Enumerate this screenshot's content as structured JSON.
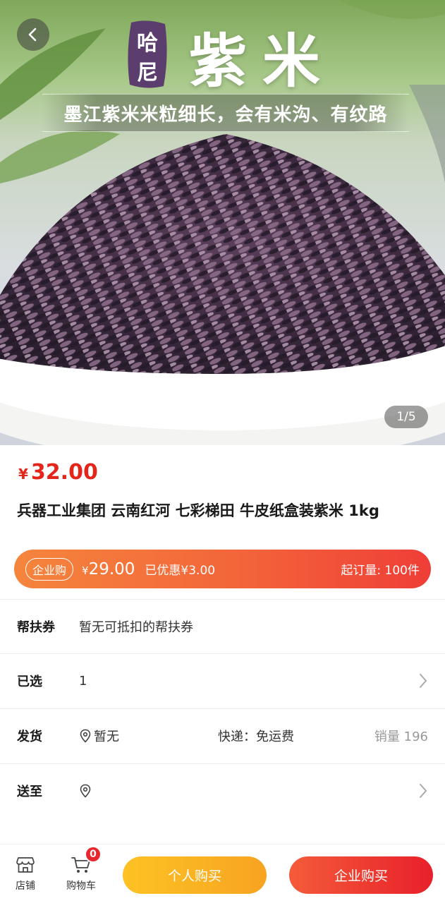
{
  "hero": {
    "brand_badge_line1": "哈",
    "brand_badge_line2": "尼",
    "title": "紫米",
    "subtitle": "墨江紫米米粒细长，会有米沟、有纹路",
    "pager": "1/5"
  },
  "product": {
    "currency_symbol": "¥",
    "price": "32.00",
    "title": "兵器工业集团 云南红河 七彩梯田 牛皮纸盒装紫米 1kg"
  },
  "enterprise": {
    "tag": "企业购",
    "currency_symbol": "¥",
    "price": "29.00",
    "saving": "已优惠¥3.00",
    "min_order": "起订量: 100件"
  },
  "rows": {
    "coupon": {
      "label": "帮扶券",
      "value": "暂无可抵扣的帮扶券"
    },
    "selected": {
      "label": "已选",
      "value": "1"
    },
    "shipping": {
      "label": "发货",
      "origin": "暂无",
      "express": "快递：免运费",
      "sales": "销量 196"
    },
    "deliver": {
      "label": "送至"
    }
  },
  "bottom_bar": {
    "shop_label": "店铺",
    "cart_label": "购物车",
    "cart_count": "0",
    "personal_buy": "个人购买",
    "enterprise_buy": "企业购买"
  },
  "colors": {
    "price_red": "#e4261a",
    "enterprise_bar_start": "#f5853c",
    "enterprise_bar_end": "#ef3e37",
    "personal_button": "#f7a421",
    "enterprise_button": "#e8202a",
    "badge_red": "#e8262d"
  },
  "icons": [
    "back-arrow-icon",
    "location-pin-icon",
    "chevron-right-icon",
    "store-icon",
    "cart-icon"
  ]
}
